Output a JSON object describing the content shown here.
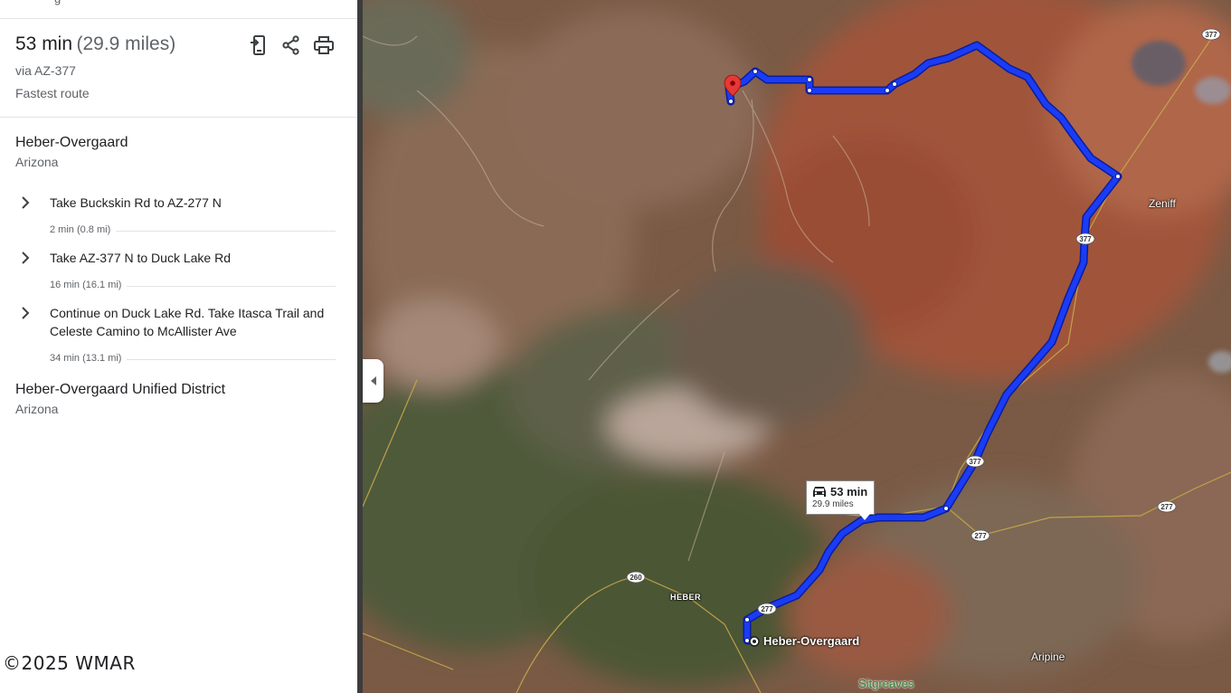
{
  "panel": {
    "top_clipped_text": "                    g                                          ",
    "summary": {
      "time": "53 min",
      "distance": "(29.9 miles)",
      "via": "via AZ-377",
      "label": "Fastest route"
    },
    "actions": [
      {
        "icon": "send-to-phone-icon"
      },
      {
        "icon": "share-icon"
      },
      {
        "icon": "print-icon"
      }
    ],
    "origin": {
      "name": "Heber-Overgaard",
      "region": "Arizona"
    },
    "steps": [
      {
        "text": "Take Buckskin Rd to AZ-277 N",
        "duration": "2 min (0.8 mi)"
      },
      {
        "text": "Take AZ-377 N to Duck Lake Rd",
        "duration": "16 min (16.1 mi)"
      },
      {
        "text": "Continue on Duck Lake Rd. Take Itasca Trail and Celeste Camino to McAllister Ave",
        "duration": "34 min (13.1 mi)"
      }
    ],
    "destination": {
      "name": "Heber-Overgaard Unified District",
      "region": "Arizona"
    }
  },
  "copyright": "©2025 WMAR",
  "map": {
    "route_box": {
      "time": "53 min",
      "distance": "29.9 miles"
    },
    "labels": {
      "zeniff": "Zeniff",
      "heber": "HEBER",
      "heber_overgaard": "Heber-Overgaard",
      "aripine": "Aripine",
      "sitgreaves": "Sitgreaves"
    },
    "shields": [
      "377",
      "377",
      "377",
      "277",
      "277",
      "277",
      "260"
    ],
    "colors": {
      "route": "#1a3cf5",
      "pin": "#e53935"
    }
  }
}
